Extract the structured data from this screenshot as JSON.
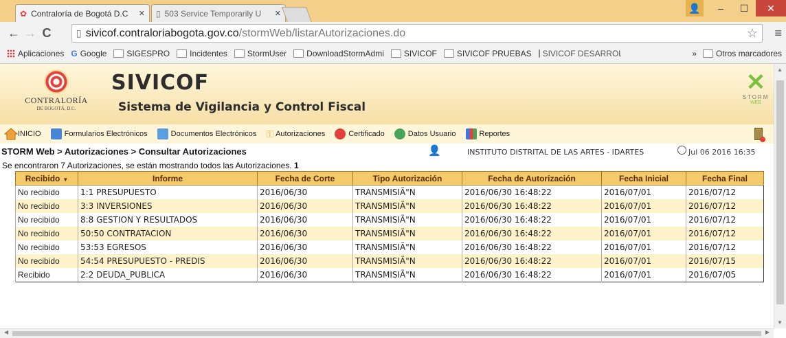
{
  "browser": {
    "tabs": [
      {
        "title": "Contraloría de Bogotá D.C",
        "active": true
      },
      {
        "title": "503 Service Temporarily U",
        "active": false
      }
    ],
    "url_host": "sivicof.contraloriabogota.gov.co",
    "url_path": "/stormWeb/listarAutorizaciones.do",
    "bookmarks": [
      {
        "label": "Aplicaciones",
        "icon": "apps-icon"
      },
      {
        "label": "Google",
        "icon": "google-icon"
      },
      {
        "label": "SIGESPRO",
        "icon": "folder-icon"
      },
      {
        "label": "Incidentes",
        "icon": "folder-icon"
      },
      {
        "label": "StormUser",
        "icon": "folder-icon"
      },
      {
        "label": "DownloadStormAdmi",
        "icon": "folder-icon"
      },
      {
        "label": "SIVICOF",
        "icon": "folder-icon"
      },
      {
        "label": "SIVICOF PRUEBAS",
        "icon": "folder-icon"
      },
      {
        "label": "SIVICOF DESARROLLO",
        "icon": "folder-icon"
      }
    ],
    "more": "»",
    "other_bookmarks": "Otros marcadores"
  },
  "header": {
    "logo_text": "CONTRALORÍA",
    "logo_sub": "DE BOGOTÁ, D.C.",
    "app_name": "SIVICOF",
    "app_subtitle": "Sistema de Vigilancia y Control Fiscal",
    "storm_label": "STORM",
    "storm_sub": "WEB"
  },
  "menu": [
    {
      "label": "INICIO",
      "icon": "home-icon",
      "color": "#f0a13c"
    },
    {
      "label": "Formularios Electrónicos",
      "icon": "forms-icon",
      "color": "#4a86d6"
    },
    {
      "label": "Documentos Electrónicos",
      "icon": "documents-icon",
      "color": "#5aa0e0"
    },
    {
      "label": "Autorizaciones",
      "icon": "key-icon",
      "color": "#d9b24a"
    },
    {
      "label": "Certificado",
      "icon": "certificate-icon",
      "color": "#e2413a"
    },
    {
      "label": "Datos Usuario",
      "icon": "users-icon",
      "color": "#4aa35a"
    },
    {
      "label": "Reportes",
      "icon": "reports-icon",
      "color": "#3b78e7"
    }
  ],
  "breadcrumb": "STORM Web > Autorizaciones > Consultar Autorizaciones",
  "organization": "INSTITUTO DISTRITAL DE LAS ARTES - IDARTES",
  "datetime": "Jul 06 2016 16:35",
  "summary_text": "Se encontraron 7 Autorizaciones, se están mostrando todos las Autorizaciones.",
  "summary_page": "1",
  "table": {
    "columns": [
      "Recibido",
      "Informe",
      "Fecha de Corte",
      "Tipo Autorización",
      "Fecha de Autorización",
      "Fecha Inicial",
      "Fecha Final"
    ],
    "rows": [
      [
        "No recibido",
        "1:1 PRESUPUESTO",
        "2016/06/30",
        "TRANSMISIÃ\"N",
        "2016/06/30 16:48:22",
        "2016/07/01",
        "2016/07/12"
      ],
      [
        "No recibido",
        "3:3 INVERSIONES",
        "2016/06/30",
        "TRANSMISIÃ\"N",
        "2016/06/30 16:48:22",
        "2016/07/01",
        "2016/07/12"
      ],
      [
        "No recibido",
        "8:8 GESTION Y RESULTADOS",
        "2016/06/30",
        "TRANSMISIÃ\"N",
        "2016/06/30 16:48:22",
        "2016/07/01",
        "2016/07/12"
      ],
      [
        "No recibido",
        "50:50 CONTRATACION",
        "2016/06/30",
        "TRANSMISIÃ\"N",
        "2016/06/30 16:48:22",
        "2016/07/01",
        "2016/07/12"
      ],
      [
        "No recibido",
        "53:53 EGRESOS",
        "2016/06/30",
        "TRANSMISIÃ\"N",
        "2016/06/30 16:48:22",
        "2016/07/01",
        "2016/07/12"
      ],
      [
        "No recibido",
        "54:54 PRESUPUESTO - PREDIS",
        "2016/06/30",
        "TRANSMISIÃ\"N",
        "2016/06/30 16:48:22",
        "2016/07/01",
        "2016/07/15"
      ],
      [
        "Recibido",
        "2:2 DEUDA_PUBLICA",
        "2016/06/30",
        "TRANSMISIÃ\"N",
        "2016/06/30 16:48:22",
        "2016/07/01",
        "2016/07/05"
      ]
    ]
  },
  "colors": {
    "header_bg": "#f4ca6a",
    "row_alt": "#fdf2c9",
    "chrome": "#f3cf8a"
  }
}
